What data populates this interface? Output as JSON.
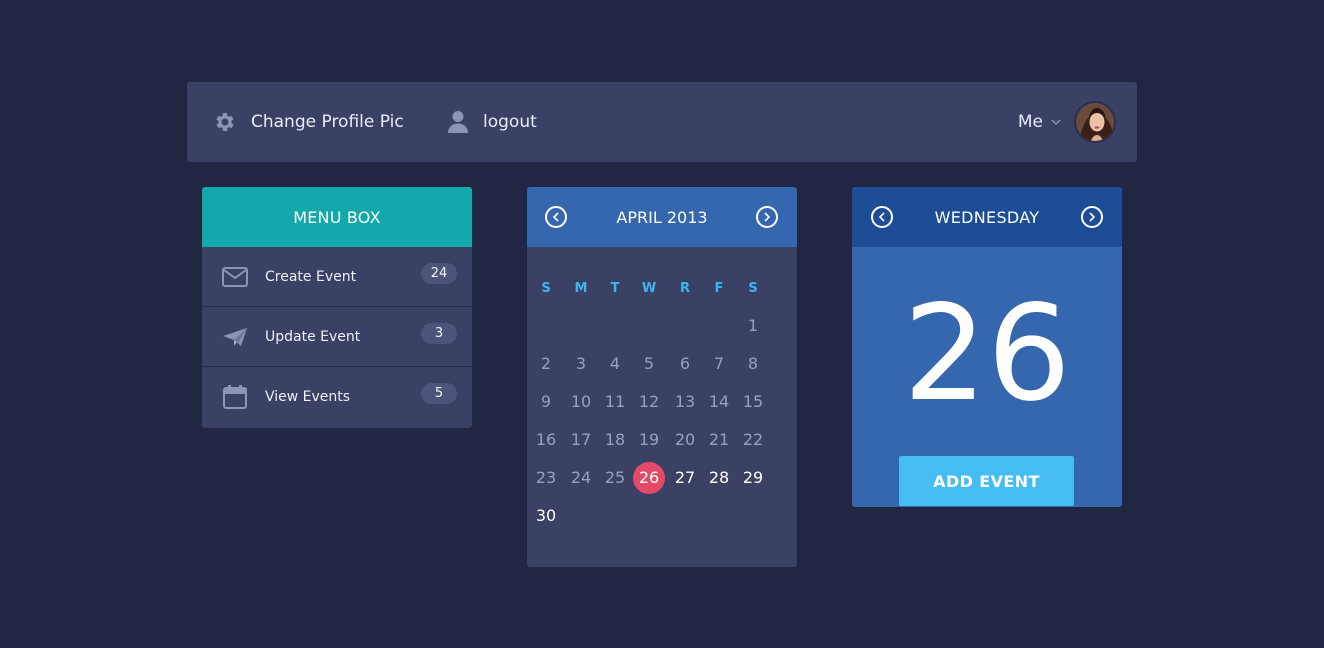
{
  "topbar": {
    "settings_label": "Change Profile Pic",
    "settings_icon": "gear-icon",
    "logout_label": "logout",
    "logout_icon": "user-icon",
    "user_menu_label": "Me",
    "user_menu_icon": "chevron-down-icon"
  },
  "menu": {
    "title": "MENU BOX",
    "items": [
      {
        "label": "Create Event",
        "icon": "envelope-icon",
        "count": "24"
      },
      {
        "label": "Update Event",
        "icon": "paper-plane-icon",
        "count": "3"
      },
      {
        "label": "View Events",
        "icon": "calendar-icon",
        "count": "5"
      }
    ]
  },
  "calendar": {
    "month_label": "APRIL 2013",
    "weekdays": [
      "S",
      "M",
      "T",
      "W",
      "R",
      "F",
      "S"
    ],
    "days": [
      "1",
      "2",
      "3",
      "4",
      "5",
      "6",
      "7",
      "8",
      "9",
      "10",
      "11",
      "12",
      "13",
      "14",
      "15",
      "16",
      "17",
      "18",
      "19",
      "20",
      "21",
      "22",
      "23",
      "24",
      "25",
      "26",
      "27",
      "28",
      "29",
      "30"
    ],
    "selected_day": "26"
  },
  "day_panel": {
    "weekday": "WEDNESDAY",
    "day_number": "26",
    "add_button": "ADD EVENT"
  },
  "colors": {
    "background": "#212642",
    "panel": "#3a4165",
    "menu_header": "#13a8ab",
    "calendar_header": "#3567af",
    "day_header": "#1d4d97",
    "today_highlight": "#e5496a",
    "weekday_text": "#3cb6f0",
    "add_button": "#45bdf2"
  }
}
